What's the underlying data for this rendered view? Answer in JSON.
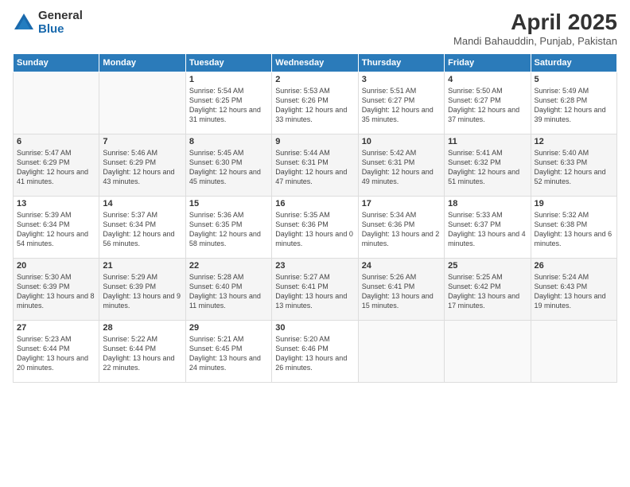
{
  "header": {
    "logo_general": "General",
    "logo_blue": "Blue",
    "title": "April 2025",
    "subtitle": "Mandi Bahauddin, Punjab, Pakistan"
  },
  "days_of_week": [
    "Sunday",
    "Monday",
    "Tuesday",
    "Wednesday",
    "Thursday",
    "Friday",
    "Saturday"
  ],
  "weeks": [
    [
      {
        "day": "",
        "info": ""
      },
      {
        "day": "",
        "info": ""
      },
      {
        "day": "1",
        "info": "Sunrise: 5:54 AM\nSunset: 6:25 PM\nDaylight: 12 hours and 31 minutes."
      },
      {
        "day": "2",
        "info": "Sunrise: 5:53 AM\nSunset: 6:26 PM\nDaylight: 12 hours and 33 minutes."
      },
      {
        "day": "3",
        "info": "Sunrise: 5:51 AM\nSunset: 6:27 PM\nDaylight: 12 hours and 35 minutes."
      },
      {
        "day": "4",
        "info": "Sunrise: 5:50 AM\nSunset: 6:27 PM\nDaylight: 12 hours and 37 minutes."
      },
      {
        "day": "5",
        "info": "Sunrise: 5:49 AM\nSunset: 6:28 PM\nDaylight: 12 hours and 39 minutes."
      }
    ],
    [
      {
        "day": "6",
        "info": "Sunrise: 5:47 AM\nSunset: 6:29 PM\nDaylight: 12 hours and 41 minutes."
      },
      {
        "day": "7",
        "info": "Sunrise: 5:46 AM\nSunset: 6:29 PM\nDaylight: 12 hours and 43 minutes."
      },
      {
        "day": "8",
        "info": "Sunrise: 5:45 AM\nSunset: 6:30 PM\nDaylight: 12 hours and 45 minutes."
      },
      {
        "day": "9",
        "info": "Sunrise: 5:44 AM\nSunset: 6:31 PM\nDaylight: 12 hours and 47 minutes."
      },
      {
        "day": "10",
        "info": "Sunrise: 5:42 AM\nSunset: 6:31 PM\nDaylight: 12 hours and 49 minutes."
      },
      {
        "day": "11",
        "info": "Sunrise: 5:41 AM\nSunset: 6:32 PM\nDaylight: 12 hours and 51 minutes."
      },
      {
        "day": "12",
        "info": "Sunrise: 5:40 AM\nSunset: 6:33 PM\nDaylight: 12 hours and 52 minutes."
      }
    ],
    [
      {
        "day": "13",
        "info": "Sunrise: 5:39 AM\nSunset: 6:34 PM\nDaylight: 12 hours and 54 minutes."
      },
      {
        "day": "14",
        "info": "Sunrise: 5:37 AM\nSunset: 6:34 PM\nDaylight: 12 hours and 56 minutes."
      },
      {
        "day": "15",
        "info": "Sunrise: 5:36 AM\nSunset: 6:35 PM\nDaylight: 12 hours and 58 minutes."
      },
      {
        "day": "16",
        "info": "Sunrise: 5:35 AM\nSunset: 6:36 PM\nDaylight: 13 hours and 0 minutes."
      },
      {
        "day": "17",
        "info": "Sunrise: 5:34 AM\nSunset: 6:36 PM\nDaylight: 13 hours and 2 minutes."
      },
      {
        "day": "18",
        "info": "Sunrise: 5:33 AM\nSunset: 6:37 PM\nDaylight: 13 hours and 4 minutes."
      },
      {
        "day": "19",
        "info": "Sunrise: 5:32 AM\nSunset: 6:38 PM\nDaylight: 13 hours and 6 minutes."
      }
    ],
    [
      {
        "day": "20",
        "info": "Sunrise: 5:30 AM\nSunset: 6:39 PM\nDaylight: 13 hours and 8 minutes."
      },
      {
        "day": "21",
        "info": "Sunrise: 5:29 AM\nSunset: 6:39 PM\nDaylight: 13 hours and 9 minutes."
      },
      {
        "day": "22",
        "info": "Sunrise: 5:28 AM\nSunset: 6:40 PM\nDaylight: 13 hours and 11 minutes."
      },
      {
        "day": "23",
        "info": "Sunrise: 5:27 AM\nSunset: 6:41 PM\nDaylight: 13 hours and 13 minutes."
      },
      {
        "day": "24",
        "info": "Sunrise: 5:26 AM\nSunset: 6:41 PM\nDaylight: 13 hours and 15 minutes."
      },
      {
        "day": "25",
        "info": "Sunrise: 5:25 AM\nSunset: 6:42 PM\nDaylight: 13 hours and 17 minutes."
      },
      {
        "day": "26",
        "info": "Sunrise: 5:24 AM\nSunset: 6:43 PM\nDaylight: 13 hours and 19 minutes."
      }
    ],
    [
      {
        "day": "27",
        "info": "Sunrise: 5:23 AM\nSunset: 6:44 PM\nDaylight: 13 hours and 20 minutes."
      },
      {
        "day": "28",
        "info": "Sunrise: 5:22 AM\nSunset: 6:44 PM\nDaylight: 13 hours and 22 minutes."
      },
      {
        "day": "29",
        "info": "Sunrise: 5:21 AM\nSunset: 6:45 PM\nDaylight: 13 hours and 24 minutes."
      },
      {
        "day": "30",
        "info": "Sunrise: 5:20 AM\nSunset: 6:46 PM\nDaylight: 13 hours and 26 minutes."
      },
      {
        "day": "",
        "info": ""
      },
      {
        "day": "",
        "info": ""
      },
      {
        "day": "",
        "info": ""
      }
    ]
  ]
}
